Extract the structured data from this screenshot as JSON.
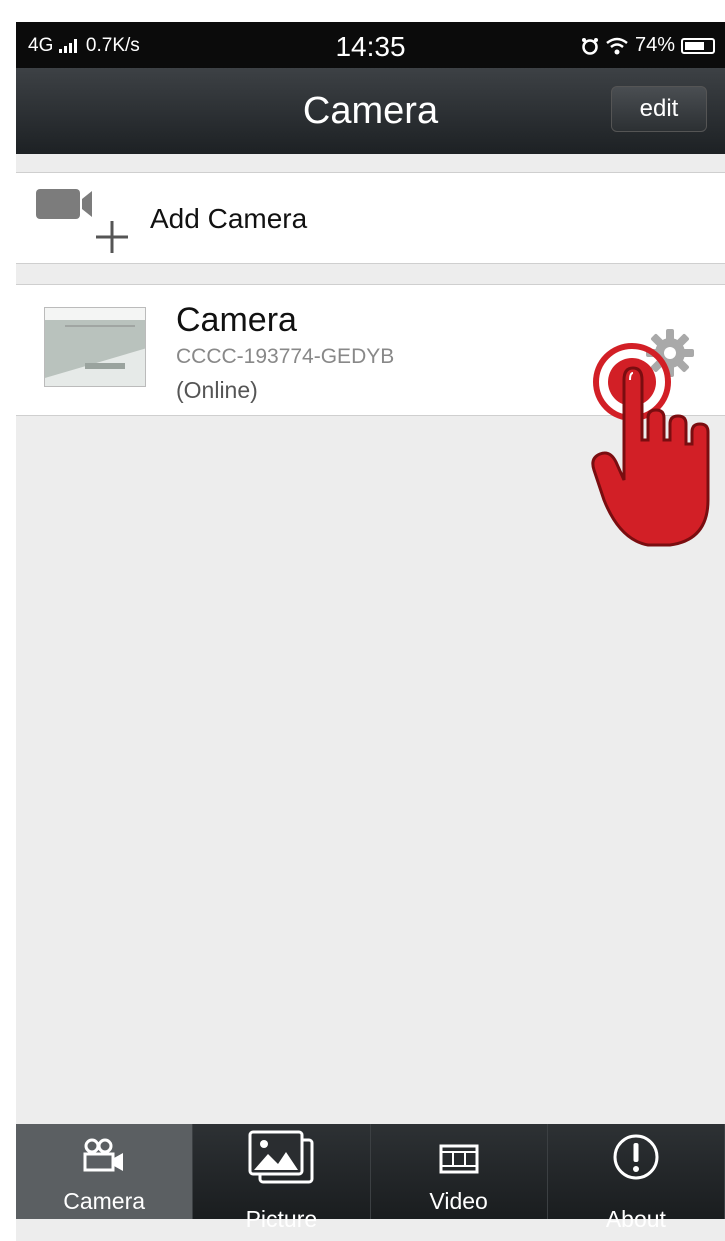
{
  "status_bar": {
    "network": "4G",
    "speed": "0.7K/s",
    "time": "14:35",
    "battery": "74%",
    "battery_level": 0.74
  },
  "nav": {
    "title": "Camera",
    "edit_label": "edit"
  },
  "add_camera": {
    "label": "Add Camera"
  },
  "cameras": [
    {
      "name": "Camera",
      "id": "CCCC-193774-GEDYB",
      "status": "(Online)"
    }
  ],
  "tabs": [
    {
      "label": "Camera",
      "icon": "camera-tab-icon",
      "active": true
    },
    {
      "label": "Picture",
      "icon": "picture-icon",
      "active": false
    },
    {
      "label": "Video",
      "icon": "film-icon",
      "active": false
    },
    {
      "label": "About",
      "icon": "info-icon",
      "active": false
    }
  ],
  "colors": {
    "nav_bg": "#2b2f32",
    "background": "#ededed",
    "hand_red": "#d21f26"
  }
}
